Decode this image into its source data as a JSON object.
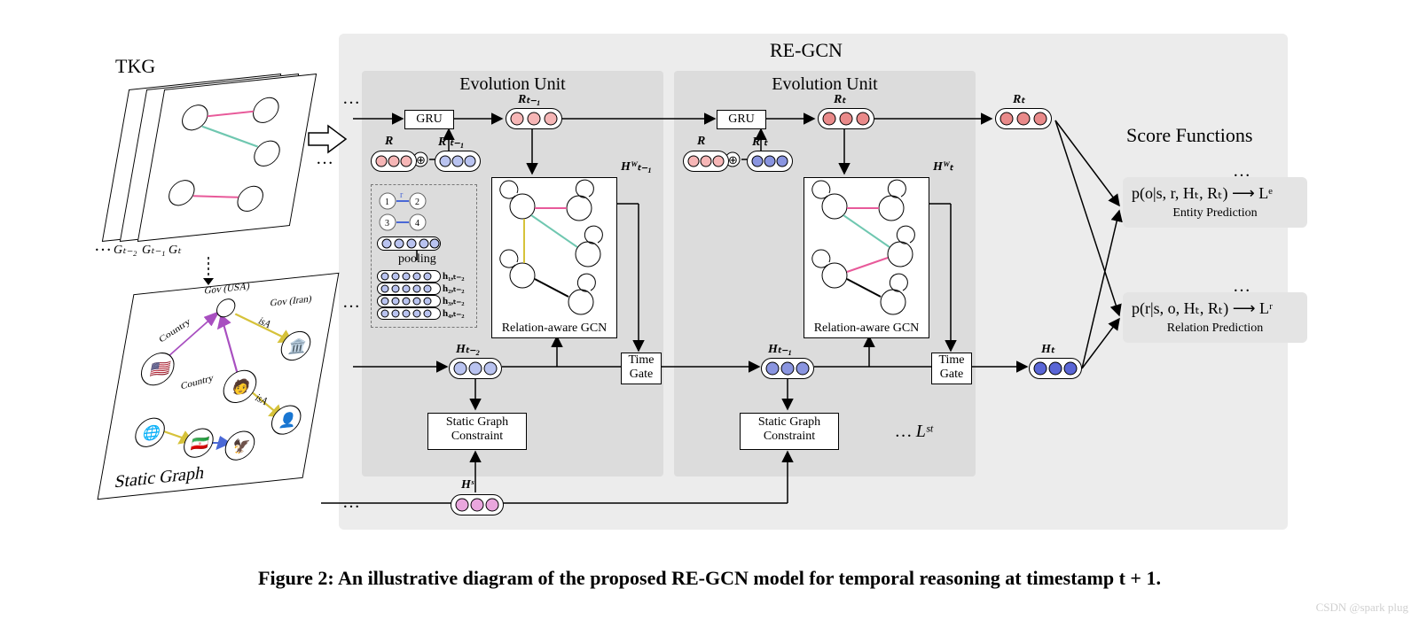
{
  "title_main": "RE-GCN",
  "tkg_label": "TKG",
  "static_graph_label": "Static Graph",
  "evolution_unit_label": "Evolution Unit",
  "gru_label": "GRU",
  "pooling_label": "pooling",
  "relation_gcn_label": "Relation-aware GCN",
  "time_gate_label1": "Time",
  "time_gate_label2": "Gate",
  "static_constraint_label1": "Static Graph",
  "static_constraint_label2": "Constraint",
  "score_title": "Score Functions",
  "entity_pred_label": "Entity Prediction",
  "relation_pred_label": "Relation Prediction",
  "entity_formula": "p(o|s, r, Hₜ, Rₜ) ⟶ Lᵉ",
  "relation_formula": "p(r|s, o, Hₜ, Rₜ) ⟶ Lʳ",
  "lst_label": "… Lˢᵗ",
  "tkg_g_labels": {
    "g0": "Gₜ₋₂",
    "g1": "Gₜ₋₁",
    "g2": "Gₜ"
  },
  "R_labels": {
    "R": "R",
    "Rp_tm1": "R′ₜ₋₁",
    "R_tm1": "Rₜ₋₁",
    "Rp_t": "R′ₜ",
    "R_t": "Rₜ",
    "R_t_out": "Rₜ"
  },
  "H_labels": {
    "H_tm2": "Hₜ₋₂",
    "Hw_tm1": "Hᵂₜ₋₁",
    "H_tm1": "Hₜ₋₁",
    "Hw_t": "Hᵂₜ",
    "H_t": "Hₜ",
    "Hs": "Hˢ"
  },
  "h_vec_labels": {
    "h1": "h₁,ₜ₋₂",
    "h2": "h₂,ₜ₋₂",
    "h3": "h₃,ₜ₋₂",
    "h4": "h₄,ₜ₋₂"
  },
  "sg_edges": {
    "gov_usa": "Gov (USA)",
    "gov_iran": "Gov (Iran)",
    "country1": "Country",
    "country2": "Country",
    "isA1": "isA",
    "isA2": "isA"
  },
  "mini_r_label": "r",
  "ellipsis": "…",
  "caption": "Figure 2: An illustrative diagram of the proposed RE-GCN model for temporal reasoning at timestamp t + 1.",
  "watermark": "CSDN @spark plug",
  "colors": {
    "pink": "#f6b6b6",
    "pink_dark": "#e98a8a",
    "blue": "#b9c3f0",
    "blue_dark": "#8a95e0",
    "magenta": "#e9a6dd"
  }
}
